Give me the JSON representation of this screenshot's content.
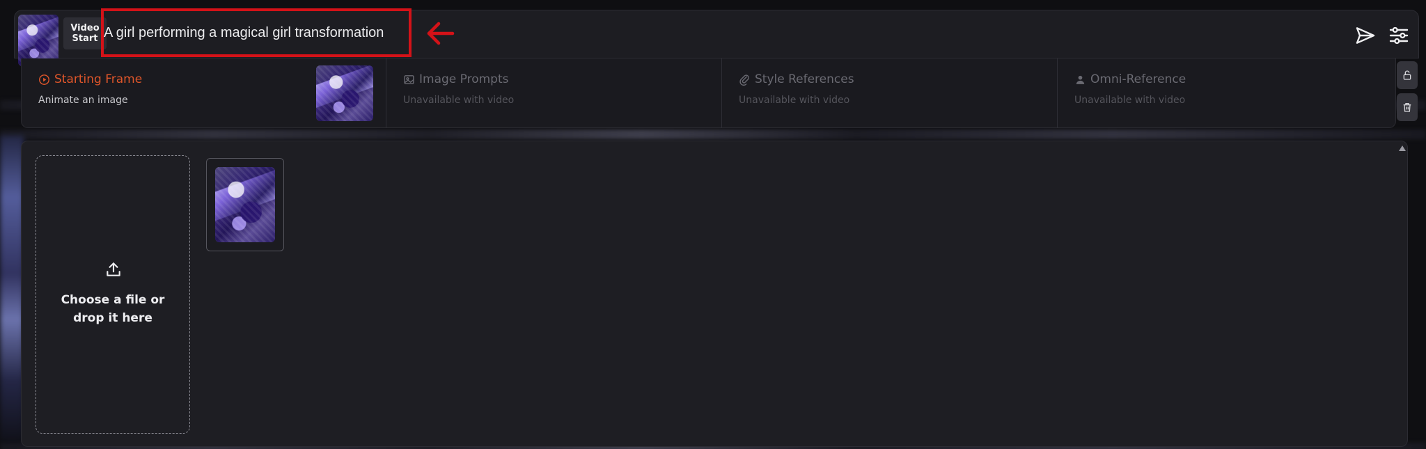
{
  "prompt_bar": {
    "mode_label_line1": "Video",
    "mode_label_line2": "Start",
    "prompt_text": "A girl performing a magical girl transformation"
  },
  "reference_panels": [
    {
      "title": "Starting Frame",
      "subtitle": "Animate an image",
      "icon": "play-circle-icon",
      "state": "active"
    },
    {
      "title": "Image Prompts",
      "subtitle": "Unavailable with video",
      "icon": "image-icon",
      "state": "disabled"
    },
    {
      "title": "Style References",
      "subtitle": "Unavailable with video",
      "icon": "paperclip-icon",
      "state": "disabled"
    },
    {
      "title": "Omni-Reference",
      "subtitle": "Unavailable with video",
      "icon": "person-icon",
      "state": "disabled"
    }
  ],
  "upload": {
    "line1": "Choose a file or",
    "line2": "drop it here"
  },
  "colors": {
    "accent_active": "#e0562a",
    "annotation_red": "#d41218",
    "panel_bg": "#1a1a1f",
    "page_bg": "#0f0f12"
  }
}
